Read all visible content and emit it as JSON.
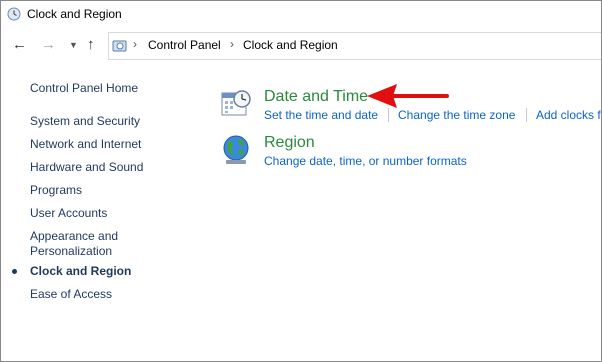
{
  "window": {
    "title": "Clock and Region"
  },
  "nav": {
    "back_icon": "back-arrow-icon",
    "forward_icon": "forward-arrow-icon",
    "recent_icon": "chevron-down-icon",
    "up_icon": "up-arrow-icon"
  },
  "address": {
    "crumbs": [
      "Control Panel",
      "Clock and Region"
    ]
  },
  "sidebar": {
    "home": "Control Panel Home",
    "items": [
      "System and Security",
      "Network and Internet",
      "Hardware and Sound",
      "Programs",
      "User Accounts",
      "Appearance and",
      "Personalization",
      "Clock and Region",
      "Ease of Access"
    ]
  },
  "main": {
    "categories": [
      {
        "title": "Date and Time",
        "icon": "calendar-clock-icon",
        "tasks": [
          "Set the time and date",
          "Change the time zone",
          "Add clocks f"
        ]
      },
      {
        "title": "Region",
        "icon": "globe-icon",
        "tasks": [
          "Change date, time, or number formats"
        ]
      }
    ]
  },
  "colors": {
    "category_title": "#2a8a3a",
    "task_link": "#0a64c8",
    "sidebar_link": "#1e395b",
    "annotation_arrow": "#e01010"
  }
}
